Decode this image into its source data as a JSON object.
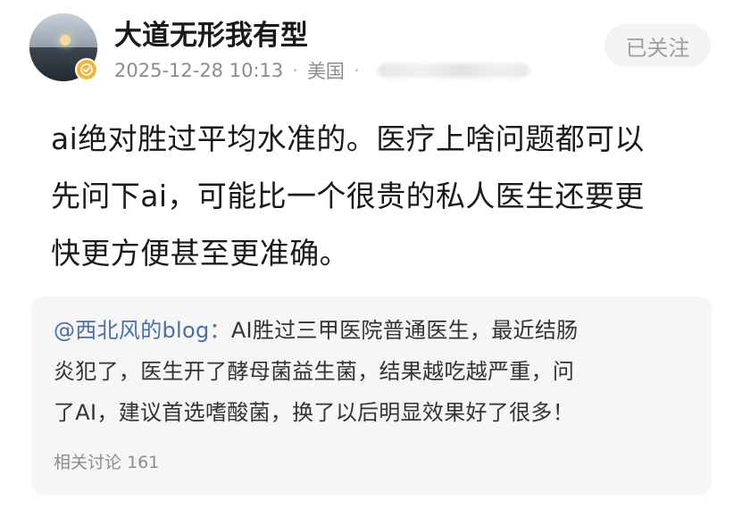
{
  "post": {
    "author": "大道无形我有型",
    "date": "2025-12-28 10:13",
    "location": "美国",
    "dot": "·",
    "follow_label": "已关注",
    "lines": [
      "ai绝对胜过平均水准的。医疗上啥问题都可以",
      "先问下ai，可能比一个很贵的私人医生还要更",
      "快更方便甚至更准确。"
    ]
  },
  "quote": {
    "mention": "@西北风的blog：",
    "line1": "AI胜过三甲医院普通医生，最近结肠",
    "line2": "炎犯了，医生开了酵母菌益生菌，结果越吃越严重，问",
    "line3": "了AI，建议首选嗜酸菌，换了以后明显效果好了很多！",
    "related_label": "相关讨论",
    "related_count": "161"
  },
  "colors": {
    "mention": "#4a6fa5",
    "badge": "#f3b63d",
    "quote_bg": "#f6f6f6",
    "meta_text": "#8c8c8c"
  },
  "icons": {
    "verified_badge": "verified-badge-icon"
  }
}
